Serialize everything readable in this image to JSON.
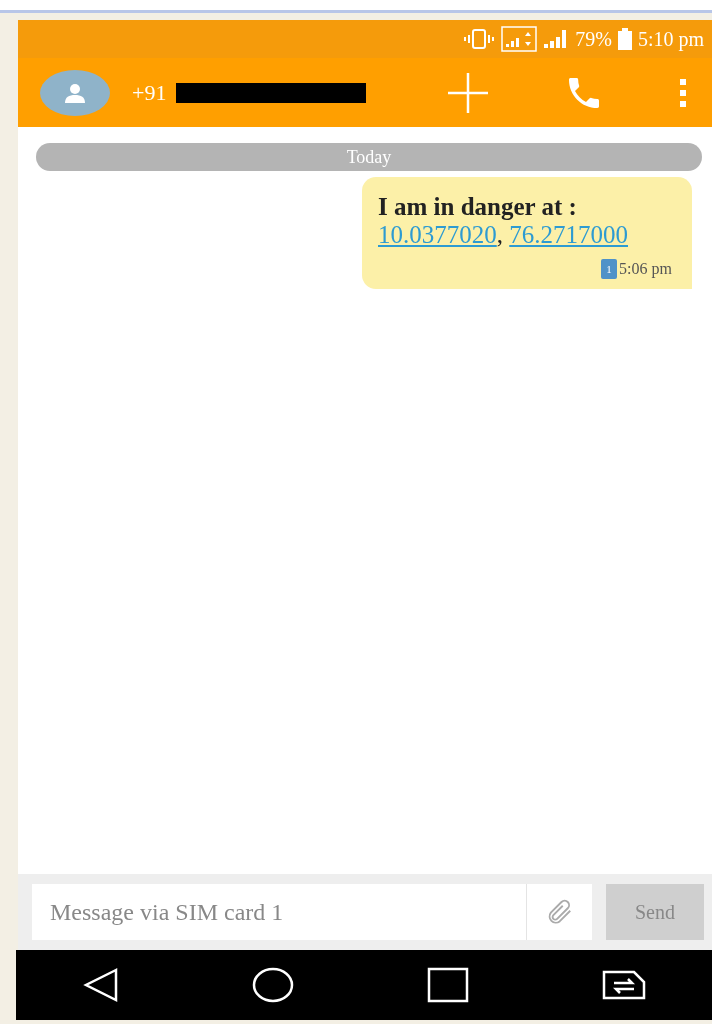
{
  "status_bar": {
    "battery": "79%",
    "time": "5:10 pm"
  },
  "header": {
    "number_prefix": "+91"
  },
  "date_divider": "Today",
  "messages": [
    {
      "text": "I am in danger at :",
      "links": [
        "10.0377020",
        "76.2717000"
      ],
      "separator": ",",
      "sim": "1",
      "time": "5:06 pm"
    }
  ],
  "composer": {
    "placeholder": "Message via SIM card 1",
    "send": "Send"
  }
}
